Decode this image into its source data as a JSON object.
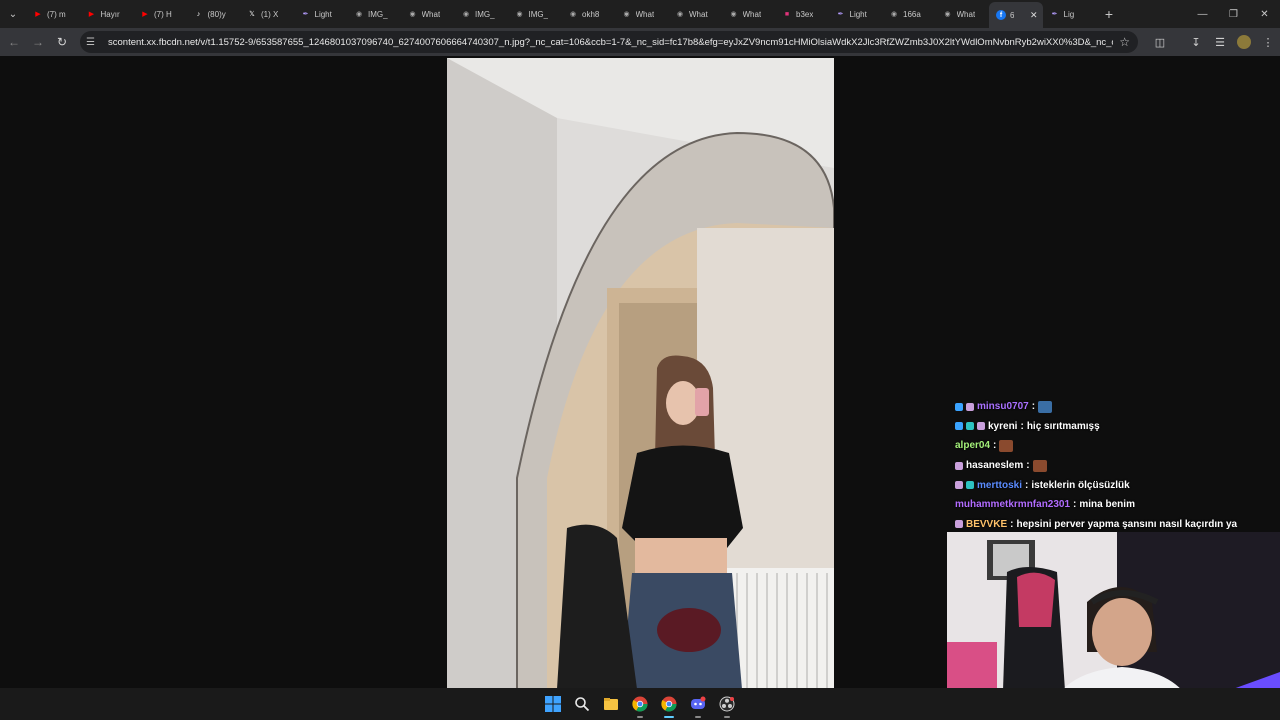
{
  "browser": {
    "tabs": [
      {
        "label": "(7) m",
        "icon": "youtube-icon",
        "color": "#ff0000"
      },
      {
        "label": "Hayır",
        "icon": "youtube-icon",
        "color": "#ff0000"
      },
      {
        "label": "(7) H",
        "icon": "youtube-icon",
        "color": "#ff0000"
      },
      {
        "label": "(80)y",
        "icon": "tiktok-icon",
        "color": "#ffffff"
      },
      {
        "label": "(1) X",
        "icon": "x-icon",
        "color": "#ffffff"
      },
      {
        "label": "Light",
        "icon": "feather-icon",
        "color": "#b49cff"
      },
      {
        "label": "IMG_",
        "icon": "globe-icon",
        "color": "#aaaaaa"
      },
      {
        "label": "What",
        "icon": "globe-icon",
        "color": "#aaaaaa"
      },
      {
        "label": "IMG_",
        "icon": "globe-icon",
        "color": "#aaaaaa"
      },
      {
        "label": "IMG_",
        "icon": "globe-icon",
        "color": "#aaaaaa"
      },
      {
        "label": "okh8",
        "icon": "globe-icon",
        "color": "#aaaaaa"
      },
      {
        "label": "What",
        "icon": "globe-icon",
        "color": "#aaaaaa"
      },
      {
        "label": "What",
        "icon": "globe-icon",
        "color": "#aaaaaa"
      },
      {
        "label": "What",
        "icon": "globe-icon",
        "color": "#aaaaaa"
      },
      {
        "label": "b3ex",
        "icon": "bookmark-icon",
        "color": "#e0337a"
      },
      {
        "label": "Light",
        "icon": "feather-icon",
        "color": "#b49cff"
      },
      {
        "label": "166a",
        "icon": "globe-icon",
        "color": "#aaaaaa"
      },
      {
        "label": "What",
        "icon": "globe-icon",
        "color": "#aaaaaa"
      },
      {
        "label": "6",
        "icon": "facebook-icon",
        "color": "#1877f2",
        "active": true
      },
      {
        "label": "Lig",
        "icon": "feather-icon",
        "color": "#b49cff"
      }
    ],
    "url": "scontent.xx.fbcdn.net/v/t1.15752-9/653587655_1246801037096740_6274007606664740307_n.jpg?_nc_cat=106&ccb=1-7&_nc_sid=fc17b8&efg=eyJxZV9ncm91cHMiOlsiaWdkX2Jlc3RfZWZmb3J0X2ltYWdlOmNvbnRyb2wiXX0%3D&_nc_ohc=QN..."
  },
  "chat": {
    "messages": [
      {
        "user": "minsu0707",
        "text": "",
        "user_color": "#a970ff",
        "badges": [
          "#3aa3ff",
          "#c9a0dc"
        ],
        "emote": "#3a6ea5"
      },
      {
        "user": "kyreni",
        "text": "hiç sırıtmamışş",
        "user_color": "#ffffff",
        "badges": [
          "#3aa3ff",
          "#2ec2c2",
          "#c9a0dc"
        ]
      },
      {
        "user": "alper04",
        "text": "",
        "user_color": "#a4f07a",
        "badges": [],
        "emote": "#8a4a2e"
      },
      {
        "user": "hasaneslem",
        "text": "",
        "user_color": "#ffffff",
        "badges": [
          "#c9a0dc"
        ],
        "emote": "#8a4a2e"
      },
      {
        "user": "merttoski",
        "text": "isteklerin ölçüsüzlük",
        "user_color": "#5b8cff",
        "badges": [
          "#c9a0dc",
          "#2ec2c2"
        ]
      },
      {
        "user": "muhammetkrmnfan2301",
        "text": "mina benim",
        "user_color": "#b26cff",
        "badges": []
      },
      {
        "user": "BEVVKE",
        "text": "hepsini perver yapma şansını nasıl kaçırdın ya",
        "user_color": "#ffc36b",
        "badges": [
          "#c9a0dc"
        ]
      }
    ]
  },
  "taskbar": {
    "apps": [
      "windows-start-icon",
      "search-icon",
      "file-explorer-icon",
      "chrome-icon",
      "chrome-icon",
      "discord-icon",
      "obs-icon"
    ]
  }
}
